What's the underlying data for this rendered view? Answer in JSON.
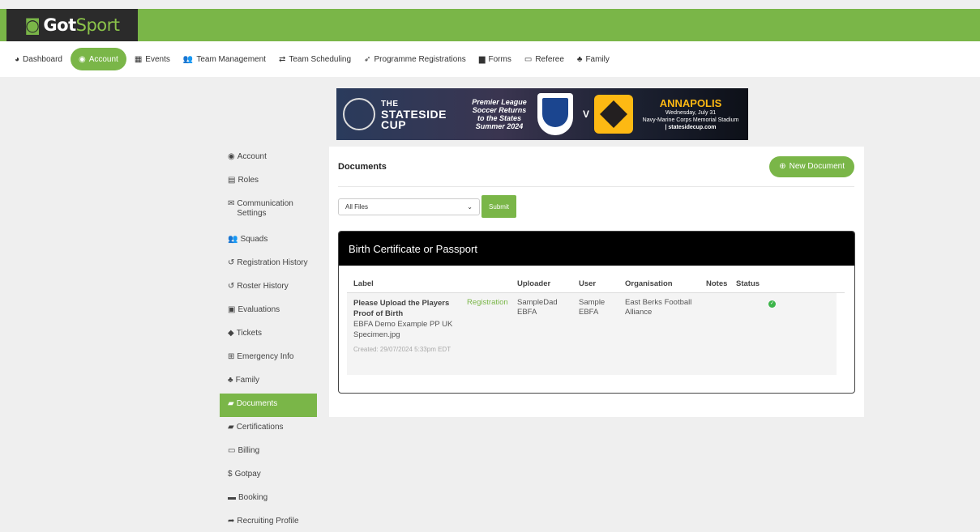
{
  "brand": {
    "name_part1": "Got",
    "name_part2": "Sport"
  },
  "nav": {
    "items": [
      {
        "label": "Dashboard",
        "icon": "tachometer-icon"
      },
      {
        "label": "Account",
        "icon": "user-circle-icon",
        "active": true
      },
      {
        "label": "Events",
        "icon": "calendar-icon"
      },
      {
        "label": "Team Management",
        "icon": "users-icon"
      },
      {
        "label": "Team Scheduling",
        "icon": "exchange-icon"
      },
      {
        "label": "Programme Registrations",
        "icon": "paper-plane-icon"
      },
      {
        "label": "Forms",
        "icon": "file-icon"
      },
      {
        "label": "Referee",
        "icon": "calendar-icon"
      },
      {
        "label": "Family",
        "icon": "sitemap-icon"
      }
    ]
  },
  "banner": {
    "cup_line1": "THE",
    "cup_line2": "STATESIDE",
    "cup_line3": "CUP",
    "promo_line1": "Premier League",
    "promo_line2": "Soccer Returns",
    "promo_line3": "to the States",
    "promo_line4": "Summer 2024",
    "vs": "V",
    "city": "ANNAPOLIS",
    "date": "Wednesday, July 31",
    "venue": "Navy-Marine Corps Memorial Stadium",
    "site": "| statesidecup.com"
  },
  "sidebar": {
    "items": [
      {
        "label": "Account",
        "icon": "user-circle-icon"
      },
      {
        "label": "Roles",
        "icon": "id-card-icon"
      },
      {
        "label": "Communication Settings",
        "icon": "envelope-icon"
      },
      {
        "label": "Squads",
        "icon": "users-icon"
      },
      {
        "label": "Registration History",
        "icon": "history-icon"
      },
      {
        "label": "Roster History",
        "icon": "history-icon"
      },
      {
        "label": "Evaluations",
        "icon": "calendar-check-icon"
      },
      {
        "label": "Tickets",
        "icon": "ticket-icon"
      },
      {
        "label": "Emergency Info",
        "icon": "plus-square-icon"
      },
      {
        "label": "Family",
        "icon": "sitemap-icon"
      },
      {
        "label": "Documents",
        "icon": "folder-open-icon",
        "active": true
      },
      {
        "label": "Certifications",
        "icon": "folder-open-icon"
      },
      {
        "label": "Billing",
        "icon": "credit-card-icon"
      },
      {
        "label": "Gotpay",
        "icon": "dollar-icon"
      },
      {
        "label": "Booking",
        "icon": "bed-icon"
      },
      {
        "label": "Recruiting Profile",
        "icon": "share-icon"
      }
    ]
  },
  "main": {
    "title": "Documents",
    "new_button": "New Document",
    "filter_value": "All Files",
    "submit_label": "Submit",
    "card_title": "Birth Certificate or Passport",
    "columns": [
      "Label",
      "",
      "Uploader",
      "User",
      "Organisation",
      "Notes",
      "Status"
    ],
    "row": {
      "label_title": "Please Upload the Players Proof of Birth",
      "file_name": "EBFA Demo Example PP UK Specimen.jpg",
      "created": "Created: 29/07/2024 5:33pm EDT",
      "type": "Registration",
      "uploader": "SampleDad EBFA",
      "user": "Sample EBFA",
      "organisation": "East Berks Football Alliance",
      "notes": "",
      "status_icon": "check-circle-icon"
    }
  },
  "colors": {
    "brand_green": "#7ab648",
    "logo_bg": "#2b2b2b",
    "card_header": "#000000"
  }
}
